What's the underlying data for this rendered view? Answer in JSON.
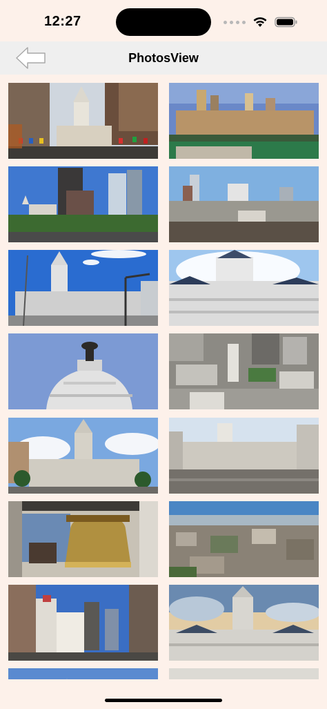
{
  "status_bar": {
    "time": "12:27"
  },
  "nav": {
    "title": "PhotosView",
    "back_icon": "back-arrow-icon"
  },
  "photos": [
    {
      "name": "photo-city-hall-street-flags"
    },
    {
      "name": "photo-skyline-over-park"
    },
    {
      "name": "photo-skyline-blue-sky"
    },
    {
      "name": "photo-skyline-rooftops"
    },
    {
      "name": "photo-city-hall-tower-streetlight"
    },
    {
      "name": "photo-city-hall-facade-white-sky"
    },
    {
      "name": "photo-dome-statue"
    },
    {
      "name": "photo-aerial-city-hall-blocks"
    },
    {
      "name": "photo-city-hall-plaza-trees"
    },
    {
      "name": "photo-city-hall-wide-street"
    },
    {
      "name": "photo-liberty-bell"
    },
    {
      "name": "photo-aerial-city-panorama"
    },
    {
      "name": "photo-narrow-street-towers"
    },
    {
      "name": "photo-city-hall-dramatic-sky"
    },
    {
      "name": "photo-partial-left"
    },
    {
      "name": "photo-partial-right"
    }
  ]
}
